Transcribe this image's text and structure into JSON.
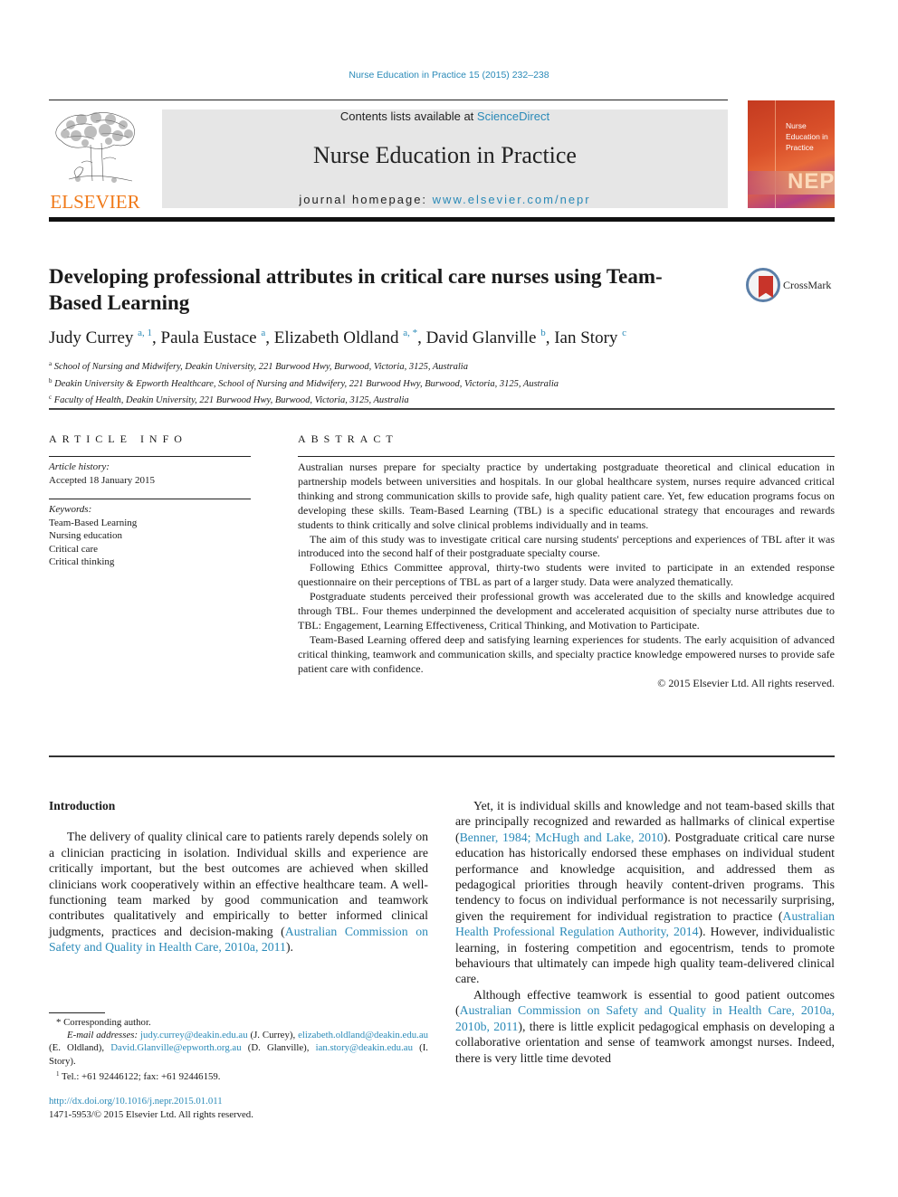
{
  "running_head": "Nurse Education in Practice 15 (2015) 232–238",
  "publisher": {
    "logo_text": "ELSEVIER",
    "logo_color": "#f07a1a"
  },
  "masthead": {
    "contents_prefix": "Contents lists available at ",
    "contents_link": "ScienceDirect",
    "journal_name": "Nurse Education in Practice",
    "homepage_prefix": "journal homepage: ",
    "homepage_link": "www.elsevier.com/nepr",
    "background_color": "#e6e6e6"
  },
  "cover": {
    "title_lines": [
      "Nurse",
      "Education in",
      "Practice"
    ],
    "acronym": "NEP"
  },
  "article": {
    "title": "Developing professional attributes in critical care nurses using Team-Based Learning",
    "crossmark_label": "CrossMark",
    "authors": [
      {
        "name": "Judy Currey",
        "marks": "a, 1"
      },
      {
        "name": "Paula Eustace",
        "marks": "a"
      },
      {
        "name": "Elizabeth Oldland",
        "marks": "a, *"
      },
      {
        "name": "David Glanville",
        "marks": "b"
      },
      {
        "name": "Ian Story",
        "marks": "c"
      }
    ],
    "affiliations": [
      {
        "mark": "a",
        "text": "School of Nursing and Midwifery, Deakin University, 221 Burwood Hwy, Burwood, Victoria, 3125, Australia"
      },
      {
        "mark": "b",
        "text": "Deakin University & Epworth Healthcare, School of Nursing and Midwifery, 221 Burwood Hwy, Burwood, Victoria, 3125, Australia"
      },
      {
        "mark": "c",
        "text": "Faculty of Health, Deakin University, 221 Burwood Hwy, Burwood, Victoria, 3125, Australia"
      }
    ]
  },
  "article_info": {
    "heading": "ARTICLE INFO",
    "history_label": "Article history:",
    "history_value": "Accepted 18 January 2015",
    "keywords_label": "Keywords:",
    "keywords": [
      "Team-Based Learning",
      "Nursing education",
      "Critical care",
      "Critical thinking"
    ]
  },
  "abstract": {
    "heading": "ABSTRACT",
    "paragraphs": [
      "Australian nurses prepare for specialty practice by undertaking postgraduate theoretical and clinical education in partnership models between universities and hospitals. In our global healthcare system, nurses require advanced critical thinking and strong communication skills to provide safe, high quality patient care. Yet, few education programs focus on developing these skills. Team-Based Learning (TBL) is a specific educational strategy that encourages and rewards students to think critically and solve clinical problems individually and in teams.",
      "The aim of this study was to investigate critical care nursing students' perceptions and experiences of TBL after it was introduced into the second half of their postgraduate specialty course.",
      "Following Ethics Committee approval, thirty-two students were invited to participate in an extended response questionnaire on their perceptions of TBL as part of a larger study. Data were analyzed thematically.",
      "Postgraduate students perceived their professional growth was accelerated due to the skills and knowledge acquired through TBL. Four themes underpinned the development and accelerated acquisition of specialty nurse attributes due to TBL: Engagement, Learning Effectiveness, Critical Thinking, and Motivation to Participate.",
      "Team-Based Learning offered deep and satisfying learning experiences for students. The early acquisition of advanced critical thinking, teamwork and communication skills, and specialty practice knowledge empowered nurses to provide safe patient care with confidence."
    ],
    "copyright": "© 2015 Elsevier Ltd. All rights reserved."
  },
  "body": {
    "section_heading": "Introduction",
    "left_paragraph": {
      "text": "The delivery of quality clinical care to patients rarely depends solely on a clinician practicing in isolation. Individual skills and experience are critically important, but the best outcomes are achieved when skilled clinicians work cooperatively within an effective healthcare team. A well-functioning team marked by good communication and teamwork contributes qualitatively and empirically to better informed clinical judgments, practices and decision-making (",
      "citation": "Australian Commission on Safety and Quality in Health Care, 2010a, 2011",
      "after": ")."
    },
    "right_paragraph_1": {
      "t1": "Yet, it is individual skills and knowledge and not team-based skills that are principally recognized and rewarded as hallmarks of clinical expertise (",
      "c1": "Benner, 1984; McHugh and Lake, 2010",
      "t2": "). Postgraduate critical care nurse education has historically endorsed these emphases on individual student performance and knowledge acquisition, and addressed them as pedagogical priorities through heavily content-driven programs. This tendency to focus on individual performance is not necessarily surprising, given the requirement for individual registration to practice (",
      "c2": "Australian Health Professional Regulation Authority, 2014",
      "t3": "). However, individualistic learning, in fostering competition and egocentrism, tends to promote behaviours that ultimately can impede high quality team-delivered clinical care."
    },
    "right_paragraph_2": {
      "t1": "Although effective teamwork is essential to good patient outcomes (",
      "c1": "Australian Commission on Safety and Quality in Health Care, 2010a, 2010b, 2011",
      "t2": "), there is little explicit pedagogical emphasis on developing a collaborative orientation and sense of teamwork amongst nurses. Indeed, there is very little time devoted"
    }
  },
  "footnotes": {
    "corresponding": "* Corresponding author.",
    "email_label": "E-mail addresses:",
    "emails": [
      {
        "address": "judy.currey@deakin.edu.au",
        "who": " (J. Currey), "
      },
      {
        "address": "elizabeth.oldland@deakin.edu.au",
        "who": " (E. Oldland), "
      },
      {
        "address": "David.Glanville@epworth.org.au",
        "who": " (D. Glanville), "
      },
      {
        "address": "ian.story@deakin.edu.au",
        "who": " (I. Story)."
      }
    ],
    "tel_mark": "1",
    "tel": " Tel.: +61 92446122; fax: +61 92446159."
  },
  "doi": {
    "link": "http://dx.doi.org/10.1016/j.nepr.2015.01.011",
    "issn_line": "1471-5953/© 2015 Elsevier Ltd. All rights reserved."
  },
  "colors": {
    "link": "#2a8ab8",
    "text": "#1a1a1a"
  }
}
